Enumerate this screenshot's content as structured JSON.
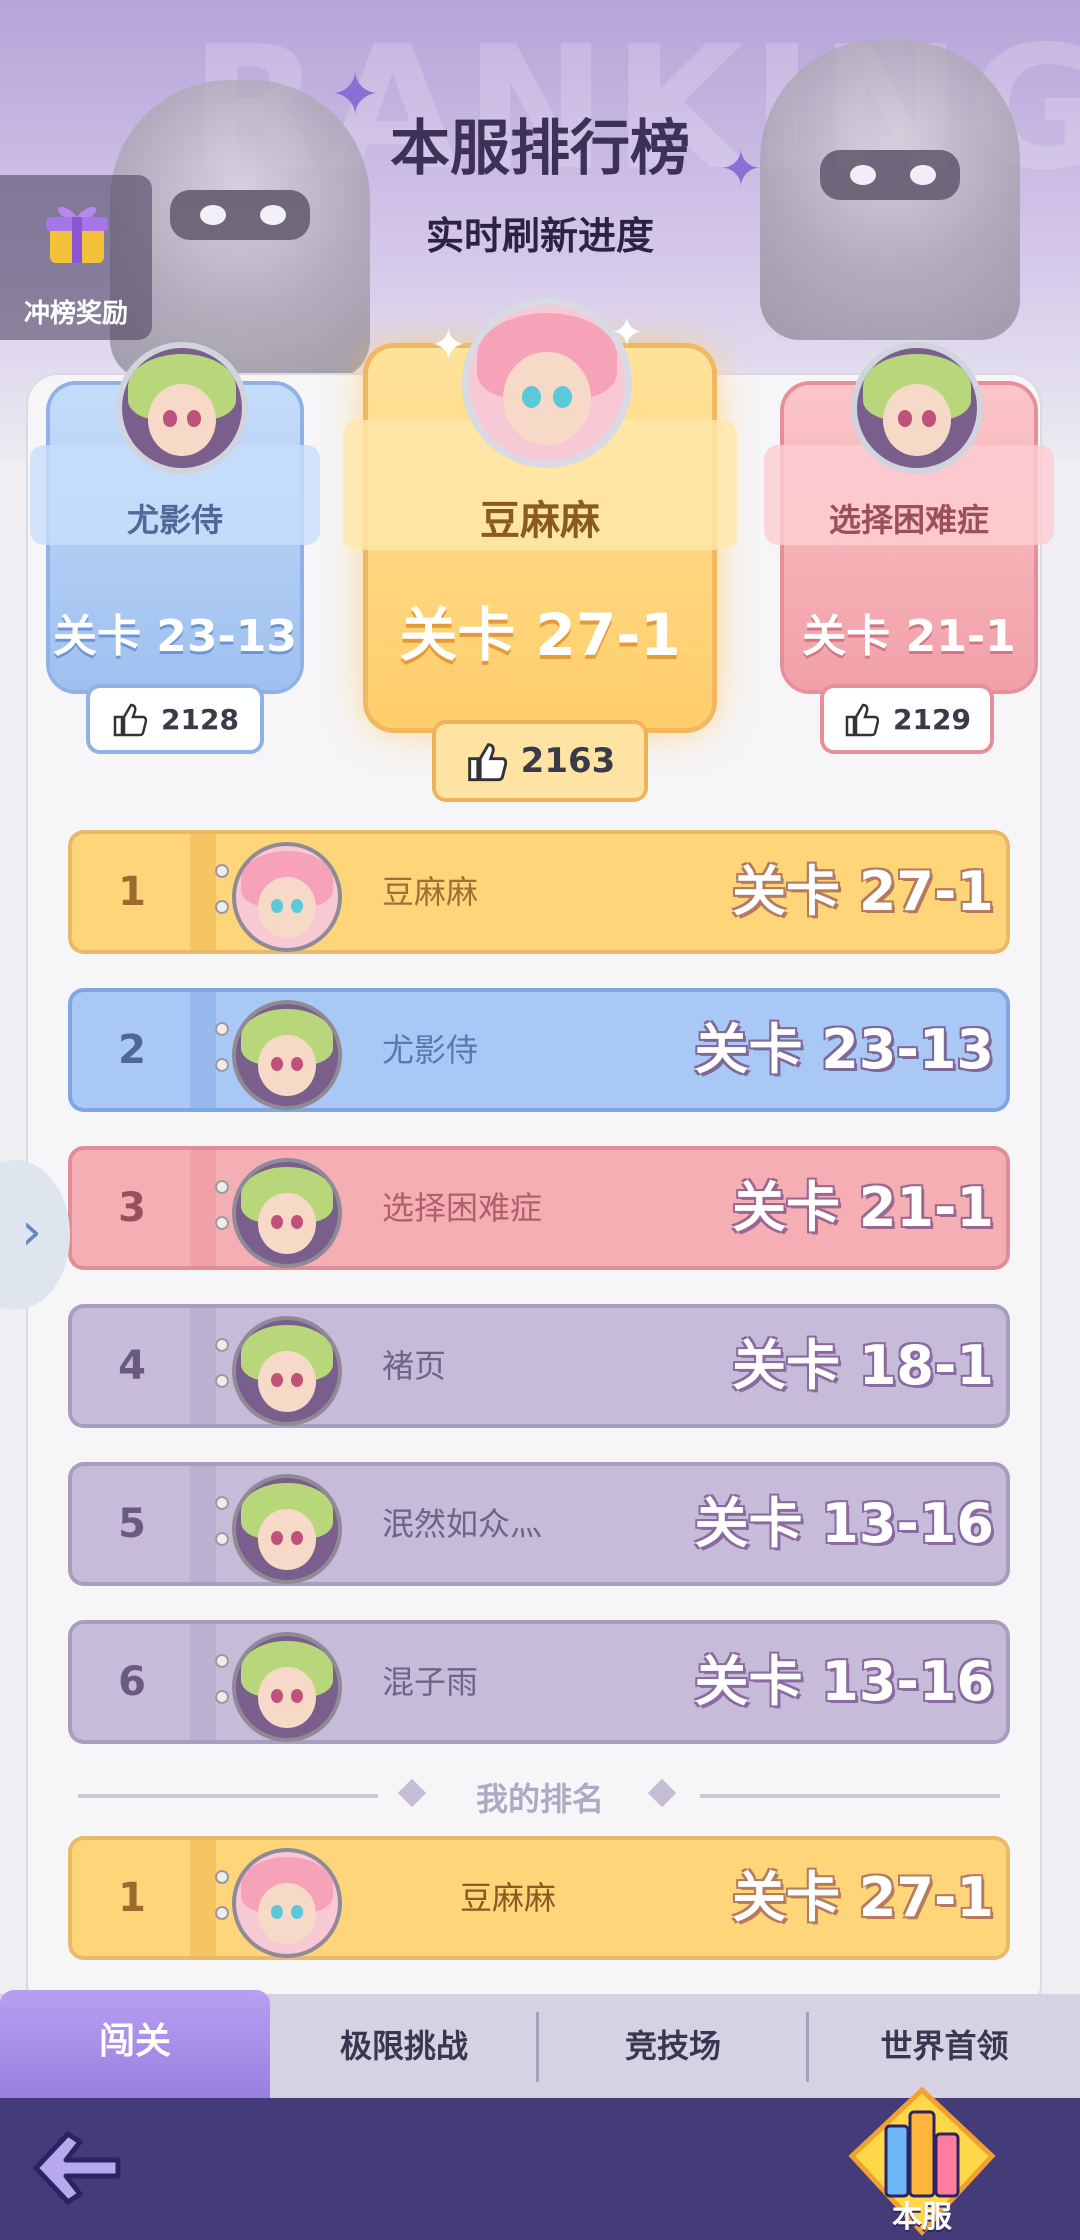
{
  "header": {
    "bg_word": "RANKING",
    "title": "本服排行榜",
    "subtitle": "实时刷新进度"
  },
  "reward_button": {
    "label": "冲榜奖励",
    "icon": "gift-box-icon"
  },
  "podium": {
    "first": {
      "name": "豆麻麻",
      "level": "关卡 27-1",
      "likes": "2163"
    },
    "second": {
      "name": "尤影侍",
      "level": "关卡 23-13",
      "likes": "2128"
    },
    "third": {
      "name": "选择困难症",
      "level": "关卡 21-1",
      "likes": "2129"
    }
  },
  "rankings": [
    {
      "rank": "1",
      "name": "豆麻麻",
      "level": "关卡 27-1",
      "avatar": "pink-hair-girl"
    },
    {
      "rank": "2",
      "name": "尤影侍",
      "level": "关卡 23-13",
      "avatar": "green-hair-girl"
    },
    {
      "rank": "3",
      "name": "选择困难症",
      "level": "关卡 21-1",
      "avatar": "green-hair-girl"
    },
    {
      "rank": "4",
      "name": "褚页",
      "level": "关卡 18-1",
      "avatar": "green-hair-girl"
    },
    {
      "rank": "5",
      "name": "泯然如众灬",
      "level": "关卡 13-16",
      "avatar": "green-hair-girl"
    },
    {
      "rank": "6",
      "name": "混子雨",
      "level": "关卡 13-16",
      "avatar": "green-hair-girl"
    }
  ],
  "my_rank_label": "我的排名",
  "my_rank": {
    "rank": "1",
    "name": "豆麻麻",
    "level": "关卡 27-1"
  },
  "tabs": [
    "闯关",
    "极限挑战",
    "竞技场",
    "世界首领"
  ],
  "active_tab": "闯关",
  "server_button_label": "本服",
  "colors": {
    "gold": "#ffd57a",
    "blue": "#a9c8f5",
    "pink": "#f6aeb5",
    "purple": "#c6bbd9",
    "tab_active": "#a88ae8",
    "bottom_bar": "#443c78"
  }
}
